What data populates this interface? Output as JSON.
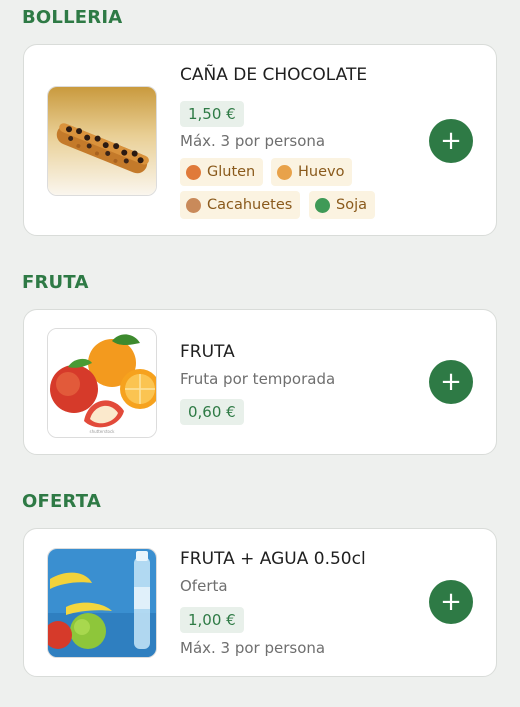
{
  "sections": [
    {
      "title": "BOLLERIA",
      "product": {
        "name": "CAÑA DE CHOCOLATE",
        "price": "1,50 €",
        "limit": "Máx. 3 por persona",
        "allergens": [
          {
            "label": "Gluten",
            "icon": "gluten-icon",
            "color": "#e07a3a"
          },
          {
            "label": "Huevo",
            "icon": "egg-icon",
            "color": "#e8a24a"
          },
          {
            "label": "Cacahuetes",
            "icon": "peanut-icon",
            "color": "#c98a5a"
          },
          {
            "label": "Soja",
            "icon": "soy-icon",
            "color": "#3f9a57"
          }
        ],
        "add_label": "+"
      }
    },
    {
      "title": "FRUTA",
      "product": {
        "name": "FRUTA",
        "description": "Fruta por temporada",
        "price": "0,60 €",
        "add_label": "+"
      }
    },
    {
      "title": "OFERTA",
      "product": {
        "name": "FRUTA + AGUA 0.50cl",
        "description": "Oferta",
        "price": "1,00 €",
        "limit": "Máx. 3 por persona",
        "add_label": "+"
      }
    }
  ],
  "colors": {
    "accent": "#2e7a45",
    "price_bg": "#e8f0ea",
    "tag_bg": "#fbf3e1",
    "tag_text": "#8a5a1c",
    "background": "#eef0ee"
  }
}
